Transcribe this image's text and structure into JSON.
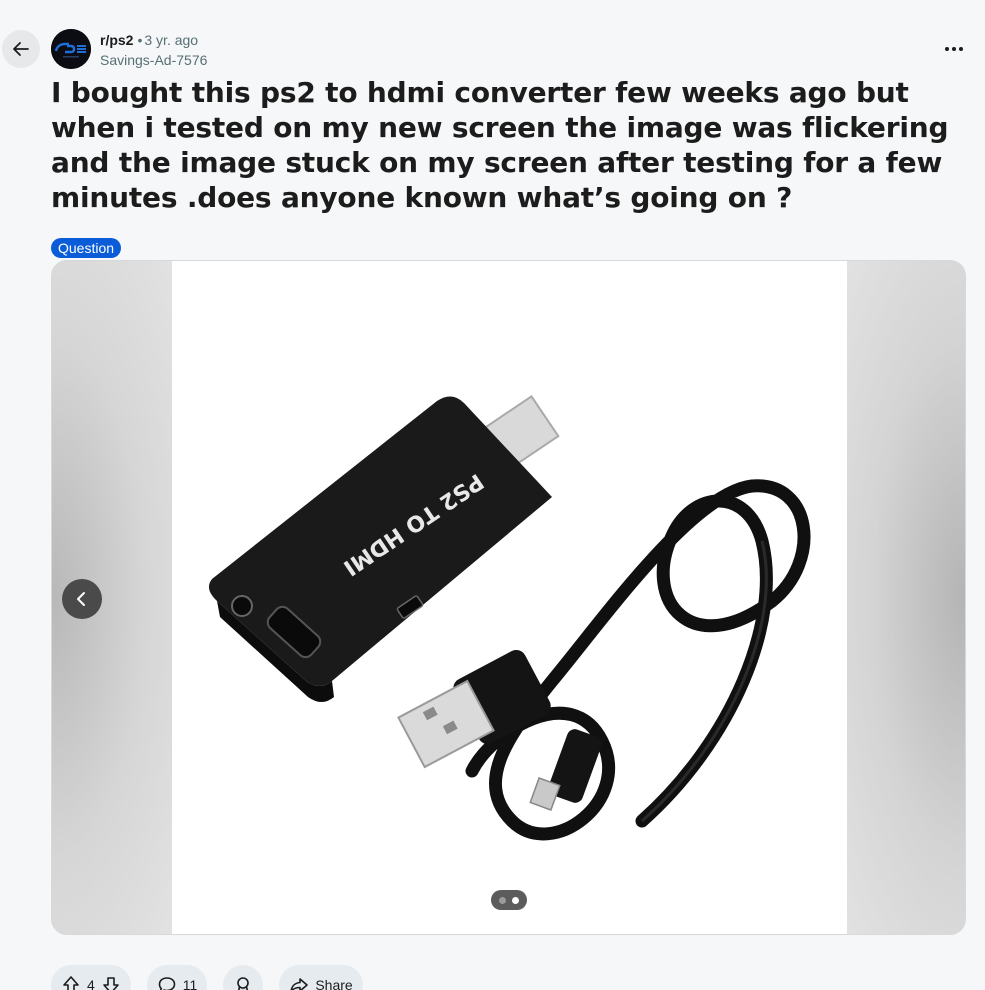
{
  "post": {
    "subreddit": "r/ps2",
    "separator": "•",
    "age": "3 yr. ago",
    "author": "Savings-Ad-7576",
    "title": "I bought this ps2 to hdmi converter few weeks ago but when i tested on my new screen the image was flickering and the image stuck on my screen after testing for a few minutes .does anyone known what’s going on ?",
    "flair": "Question"
  },
  "gallery": {
    "image_text": "PS2 TO HDMI",
    "slides_total": 2,
    "active_slide": 2
  },
  "actions": {
    "upvotes": "4",
    "comments": "11",
    "share_label": "Share"
  },
  "colors": {
    "background": "#f6f7f8",
    "flair": "#0a5cd8",
    "pill": "#e5ebee",
    "muted_text": "#576f76"
  },
  "icons": {
    "back": "arrow-left-icon",
    "more": "ellipsis-icon",
    "prev": "chevron-left-icon",
    "upvote": "arrow-up-icon",
    "downvote": "arrow-down-icon",
    "comment": "speech-bubble-icon",
    "award": "award-icon",
    "share": "share-arrow-icon"
  }
}
